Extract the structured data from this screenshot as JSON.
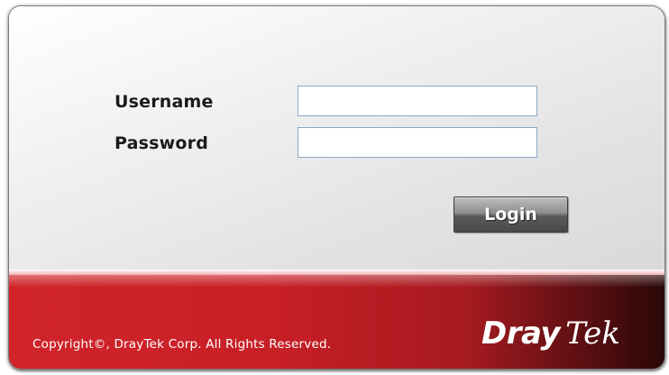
{
  "login_form": {
    "username_label": "Username",
    "password_label": "Password",
    "username_value": "",
    "password_value": "",
    "login_button_label": "Login"
  },
  "footer": {
    "copyright": "Copyright©, DrayTek Corp. All Rights Reserved.",
    "brand_part1": "Dray",
    "brand_part2": "Tek"
  },
  "colors": {
    "footer_red": "#c81f26",
    "footer_dark": "#2a0707",
    "field_border": "#8da6c8",
    "label_text": "#1a1a1a"
  }
}
